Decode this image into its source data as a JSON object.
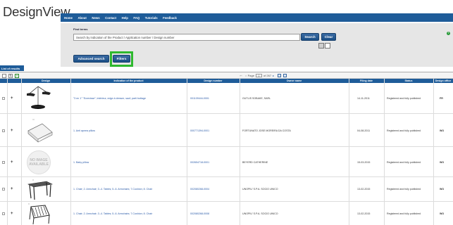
{
  "header": {
    "logo": "DesignView",
    "nav": [
      "Home",
      "About",
      "News",
      "Contact",
      "Help",
      "FAQ",
      "Tutorials",
      "Feedback"
    ]
  },
  "search": {
    "title": "Find terms",
    "placeholder": "Search by indication of the Product / Application number / Design number",
    "search_label": "Search",
    "clear_label": "Clear",
    "advanced_label": "Advanced search",
    "filters_label": "Filters",
    "help_icon": "?"
  },
  "results": {
    "tab_label": "List of results",
    "pager": {
      "page_label": "Page",
      "page_value": "1",
      "of_label": "of 267"
    },
    "columns": [
      "Design",
      "Indication of the product",
      "Design number",
      "Owner name",
      "Filing date",
      "Status",
      "Design office"
    ],
    "rows": [
      {
        "thumb": "lamp-icon",
        "indication": "\"3 en 1\" \"Ecrevisse\"; intérieur, edge à dresser, sauf; parti bottage",
        "number": "001109444-0001",
        "owner": "GUTLIS SOBAKE, SARL",
        "date": "14-11-2011",
        "status": "Registered and fully published",
        "office": "FR"
      },
      {
        "thumb": "pillow-icon",
        "indication": "1. Anti apnea pillow",
        "number": "000771394-0001",
        "owner": "FORTUNATO JOSE MOREIRA DA COSTA",
        "date": "04-08-2011",
        "status": "Registered and fully published",
        "office": "WO"
      },
      {
        "thumb": "no-image-icon",
        "no_image_text": "NO IMAGE AVAILABLE",
        "indication": "1. Baby pillow",
        "number": "002654718-0001",
        "owner": "BEYERD CATHERINE",
        "date": "15-03-2015",
        "status": "Registered and fully published",
        "office": "WO"
      },
      {
        "thumb": "table-icon",
        "indication": "1. Chair; 2. Armchair; 3.-4. Tables; 5.-6. Armchairs; 7.Cushion; 8. Chair",
        "number": "002080268-0004",
        "owner": "UNOPIU' S.P.A. SOCIO UNICO",
        "date": "13-02-2015",
        "status": "Registered and fully published",
        "office": "WO"
      },
      {
        "thumb": "chair-icon",
        "indication": "1. Chair; 2. Armchair; 3.-4. Tables; 5.-6. Armchairs; 7.Cushion; 8. Chair",
        "number": "002080268-0008",
        "owner": "UNOPIU' S.P.A. SOCIO UNICO",
        "date": "13-02-2015",
        "status": "Registered and fully published",
        "office": "WO"
      }
    ]
  },
  "colors": {
    "nav_blue": "#1e5c99",
    "highlight_green": "#2eb82e",
    "link_blue": "#2a5aa8"
  }
}
